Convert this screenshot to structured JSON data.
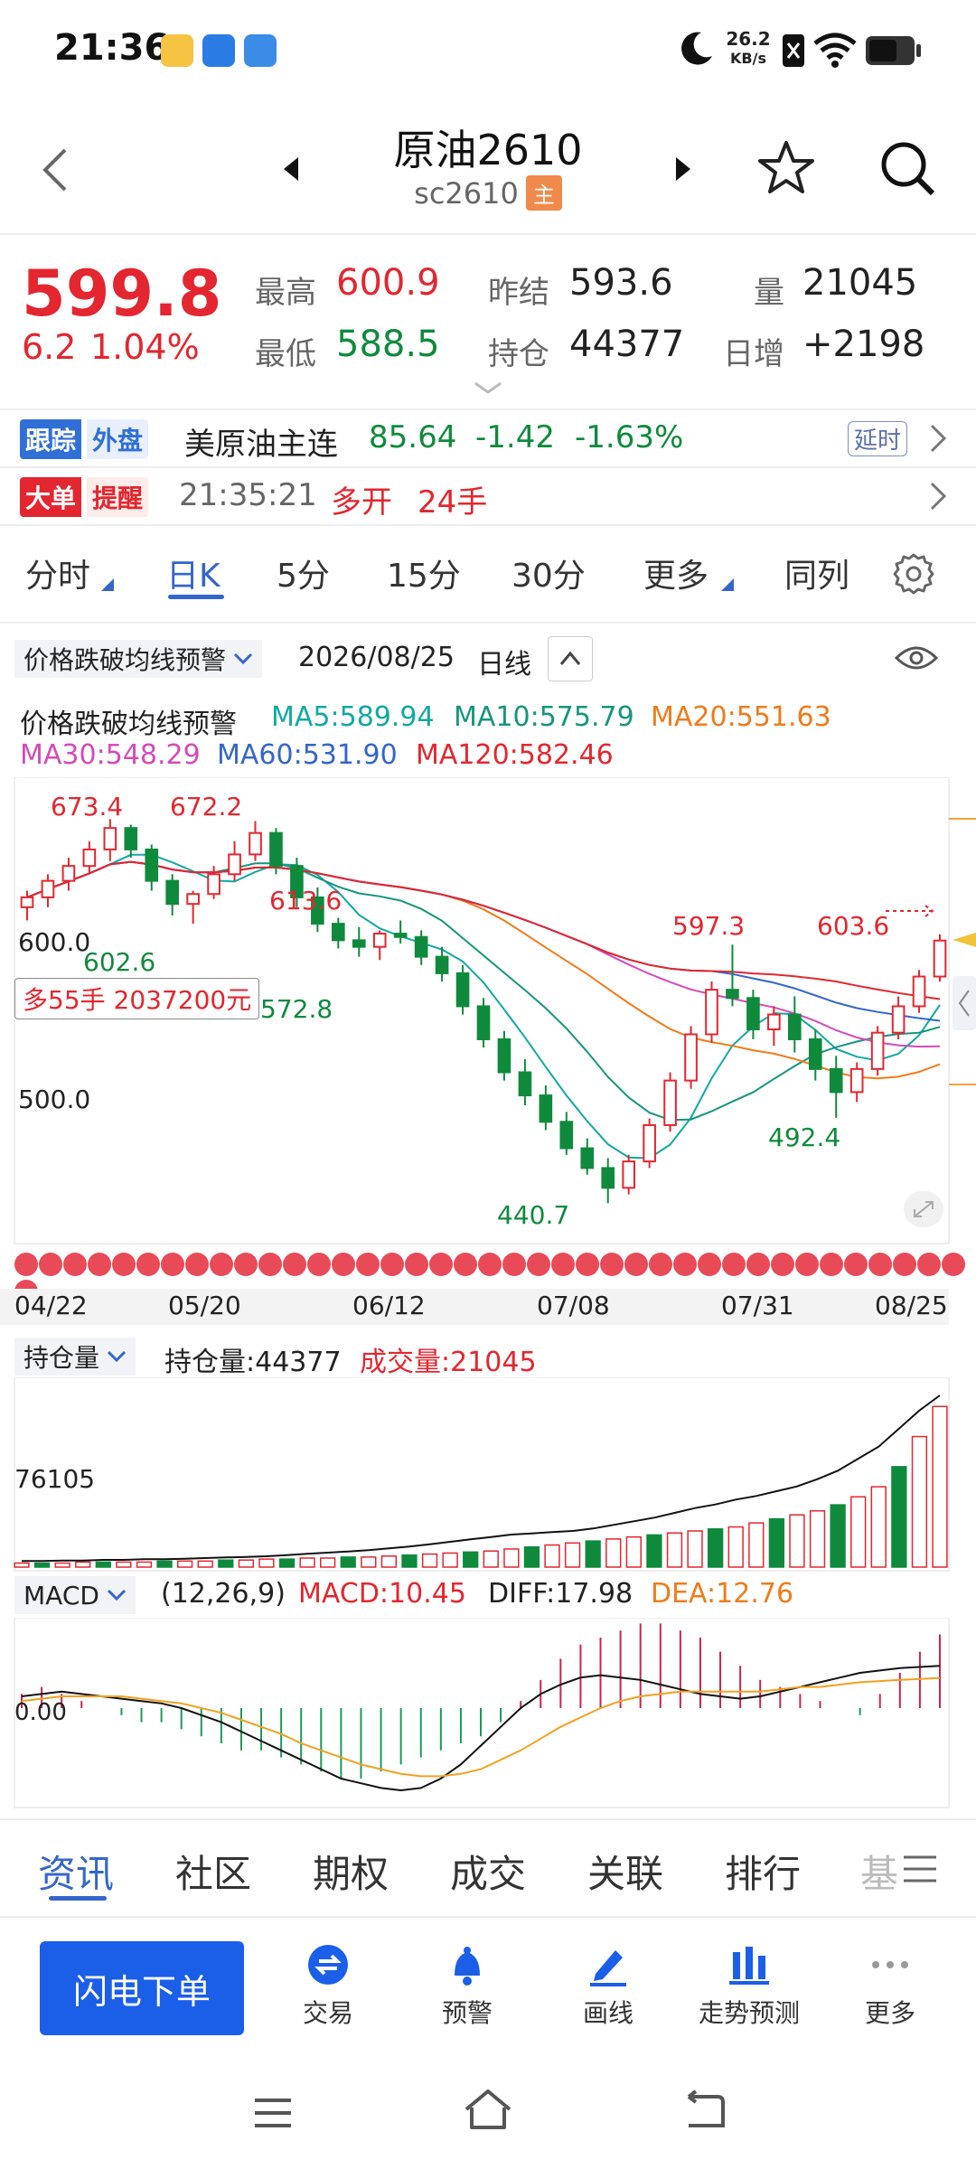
{
  "status_bar": {
    "time": "21:36",
    "net_speed_value": "26.2",
    "net_speed_unit": "KB/s"
  },
  "header": {
    "title": "原油2610",
    "code": "sc2610",
    "main_badge": "主"
  },
  "quote": {
    "price": "599.8",
    "change": "6.2",
    "change_pct": "1.04%",
    "high_label": "最高",
    "high": "600.9",
    "low_label": "最低",
    "low": "588.5",
    "prev_settle_label": "昨结",
    "prev_settle": "593.6",
    "open_interest_label": "持仓",
    "open_interest": "44377",
    "volume_label": "量",
    "volume": "21045",
    "daily_inc_label": "日增",
    "daily_inc": "+2198"
  },
  "foreign": {
    "badge1": "跟踪",
    "badge2": "外盘",
    "name": "美原油主连",
    "price": "85.64",
    "change": "-1.42",
    "pct": "-1.63%",
    "delay": "延时"
  },
  "big_order": {
    "badge1": "大单",
    "badge2": "提醒",
    "time": "21:35:21",
    "action": "多开",
    "qty": "24手"
  },
  "period_tabs": {
    "t1": "分时",
    "t2": "日K",
    "t3": "5分",
    "t4": "15分",
    "t5": "30分",
    "t6": "更多",
    "t7": "同列"
  },
  "indicator_bar": {
    "select": "价格跌破均线预警",
    "date": "2026/08/25",
    "period": "日线"
  },
  "ma": {
    "name": "价格跌破均线预警",
    "ma5": "MA5:589.94",
    "ma10": "MA10:575.79",
    "ma20": "MA20:551.63",
    "ma30": "MA30:548.29",
    "ma60": "MA60:531.90",
    "ma120": "MA120:582.46"
  },
  "chart_data": [
    {
      "type": "candlestick",
      "title": "",
      "x_ticks": [
        "04/22",
        "05/20",
        "06/12",
        "07/08",
        "07/31",
        "08/25"
      ],
      "y_ticks": [
        "600.0",
        "500.0"
      ],
      "annotations": [
        "673.4",
        "672.2",
        "613.6",
        "602.6",
        "572.8",
        "440.7",
        "597.3",
        "492.4",
        "603.6"
      ],
      "position_box": "多55手 2037200元",
      "ohlc": [
        [
          620,
          630,
          612,
          626
        ],
        [
          626,
          640,
          620,
          636
        ],
        [
          636,
          650,
          630,
          645
        ],
        [
          645,
          660,
          640,
          655
        ],
        [
          655,
          673.4,
          648,
          668
        ],
        [
          668,
          670,
          650,
          655
        ],
        [
          655,
          658,
          630,
          636
        ],
        [
          636,
          640,
          615,
          622
        ],
        [
          622,
          630,
          610,
          628
        ],
        [
          628,
          645,
          625,
          640
        ],
        [
          640,
          660,
          636,
          652
        ],
        [
          652,
          672.2,
          648,
          665
        ],
        [
          665,
          668,
          640,
          645
        ],
        [
          645,
          650,
          620,
          626
        ],
        [
          626,
          632,
          605,
          610
        ],
        [
          610,
          613.6,
          595,
          600
        ],
        [
          600,
          608,
          590,
          596
        ],
        [
          596,
          606,
          588,
          604
        ],
        [
          604,
          612,
          598,
          602
        ],
        [
          602,
          606,
          585,
          590
        ],
        [
          590,
          596,
          575,
          580
        ],
        [
          580,
          585,
          555,
          560
        ],
        [
          560,
          565,
          535,
          540
        ],
        [
          540,
          545,
          515,
          520
        ],
        [
          520,
          528,
          500,
          506
        ],
        [
          506,
          512,
          485,
          490
        ],
        [
          490,
          496,
          470,
          474
        ],
        [
          474,
          480,
          458,
          462
        ],
        [
          462,
          468,
          440.7,
          450
        ],
        [
          450,
          470,
          446,
          466
        ],
        [
          466,
          492,
          462,
          488
        ],
        [
          488,
          520,
          484,
          515
        ],
        [
          515,
          548,
          510,
          543
        ],
        [
          543,
          575,
          538,
          570
        ],
        [
          570,
          597.3,
          560,
          565
        ],
        [
          565,
          570,
          540,
          546
        ],
        [
          546,
          560,
          536,
          555
        ],
        [
          555,
          566,
          532,
          540
        ],
        [
          540,
          546,
          515,
          522
        ],
        [
          522,
          530,
          492.4,
          508
        ],
        [
          508,
          526,
          502,
          522
        ],
        [
          522,
          548,
          518,
          544
        ],
        [
          544,
          566,
          540,
          560
        ],
        [
          560,
          582,
          556,
          578
        ],
        [
          578,
          603.6,
          575,
          599.8
        ]
      ],
      "indicators": [
        "MA5",
        "MA10",
        "MA20",
        "MA30",
        "MA60",
        "MA120"
      ]
    },
    {
      "type": "bar",
      "title": "",
      "series": [
        {
          "name": "持仓量:44377",
          "values": [
            10,
            10,
            11,
            11,
            12,
            12,
            13,
            13,
            14,
            15,
            16,
            17,
            18,
            20,
            22,
            24,
            26,
            28,
            31,
            34,
            38,
            42,
            46,
            50,
            54,
            56,
            58,
            60,
            64,
            70,
            76,
            82,
            90,
            98,
            104,
            112,
            118,
            126,
            134,
            146,
            160,
            180,
            200,
            230,
            260,
            285
          ]
        },
        {
          "name": "成交量:21045",
          "values": [
            4,
            4,
            4,
            5,
            5,
            5,
            5,
            6,
            6,
            6,
            7,
            7,
            8,
            8,
            9,
            9,
            10,
            10,
            11,
            12,
            13,
            14,
            15,
            16,
            18,
            20,
            22,
            24,
            26,
            28,
            30,
            32,
            34,
            36,
            38,
            40,
            44,
            48,
            52,
            56,
            62,
            70,
            80,
            100,
            130,
            160
          ]
        }
      ],
      "y_ticks": [
        "76105"
      ]
    },
    {
      "type": "bar",
      "title": "",
      "params": "(12,26,9)",
      "series": [
        {
          "name": "MACD:10.45",
          "values": [
            2,
            3,
            2,
            1,
            0,
            -1,
            -2,
            -2,
            -3,
            -4,
            -5,
            -6,
            -6,
            -7,
            -8,
            -9,
            -10,
            -10,
            -9,
            -8,
            -7,
            -6,
            -5,
            -4,
            -2,
            1,
            4,
            7,
            9,
            10,
            11,
            12,
            12,
            11,
            10,
            8,
            6,
            4,
            3,
            2,
            1,
            0,
            -1,
            2,
            5,
            8,
            10.45
          ]
        },
        {
          "name": "DIFF:17.98",
          "values": [
            5,
            6,
            7,
            6,
            5,
            4,
            3,
            2,
            0,
            -3,
            -6,
            -10,
            -14,
            -18,
            -22,
            -26,
            -30,
            -32,
            -34,
            -35,
            -34,
            -30,
            -24,
            -16,
            -8,
            0,
            6,
            10,
            13,
            14,
            13,
            12,
            10,
            8,
            6,
            5,
            4,
            5,
            7,
            9,
            11,
            13,
            15,
            16,
            17,
            17.5,
            17.98
          ]
        },
        {
          "name": "DEA:12.76",
          "values": [
            3,
            4,
            5,
            5,
            5,
            5,
            4,
            3,
            2,
            0,
            -2,
            -5,
            -8,
            -11,
            -15,
            -18,
            -21,
            -24,
            -26,
            -28,
            -29,
            -29,
            -28,
            -26,
            -22,
            -18,
            -13,
            -8,
            -4,
            0,
            3,
            5,
            6,
            7,
            7,
            7,
            7,
            7,
            8,
            9,
            9,
            10,
            11,
            11.5,
            12,
            12.4,
            12.76
          ]
        }
      ],
      "y_ticks": [
        "0.00"
      ]
    }
  ],
  "oi_bar": {
    "select": "持仓量",
    "oi": "持仓量:44377",
    "vol": "成交量:21045"
  },
  "macd_bar": {
    "select": "MACD",
    "params": "(12,26,9)",
    "macd": "MACD:10.45",
    "diff": "DIFF:17.98",
    "dea": "DEA:12.76"
  },
  "sub_tabs": {
    "s1": "资讯",
    "s2": "社区",
    "s3": "期权",
    "s4": "成交",
    "s5": "关联",
    "s6": "排行",
    "s7": "基"
  },
  "toolbar": {
    "order_button": "闪电下单",
    "trade": "交易",
    "alert": "预警",
    "draw": "画线",
    "forecast": "走势预测",
    "more": "更多"
  }
}
